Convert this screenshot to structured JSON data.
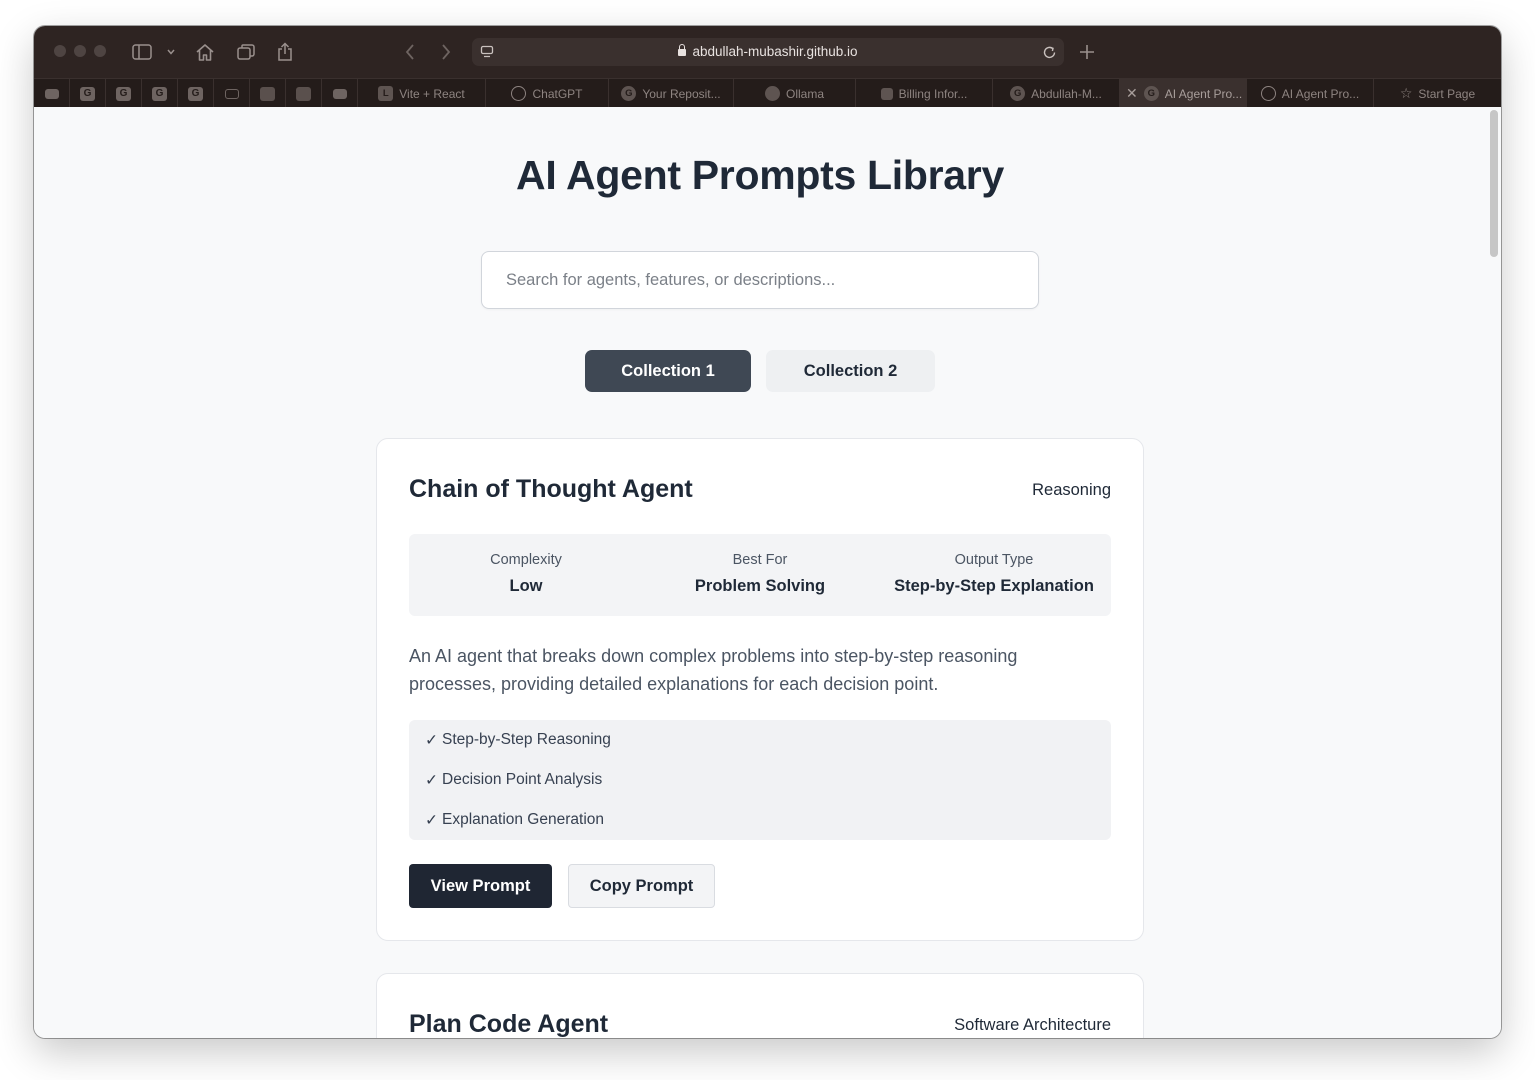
{
  "browser": {
    "url": "abdullah-mubashir.github.io",
    "pinned_tabs": [
      {
        "icon": "youtube-icon",
        "letter": ""
      },
      {
        "icon": "github-icon",
        "letter": "G"
      },
      {
        "icon": "github-icon",
        "letter": "G"
      },
      {
        "icon": "github-icon",
        "letter": "G"
      },
      {
        "icon": "github-icon",
        "letter": "G"
      },
      {
        "icon": "list-icon",
        "letter": ""
      },
      {
        "icon": "image-icon",
        "letter": ""
      },
      {
        "icon": "image-icon",
        "letter": ""
      },
      {
        "icon": "youtube-icon",
        "letter": ""
      }
    ],
    "tabs": [
      {
        "label": "Vite + React",
        "icon_letter": "L"
      },
      {
        "label": "ChatGPT",
        "icon_letter": "✱"
      },
      {
        "label": "Your Reposit...",
        "icon_letter": "G"
      },
      {
        "label": "Ollama",
        "icon_letter": "☺"
      },
      {
        "label": "Billing Infor...",
        "icon_letter": "⚲"
      },
      {
        "label": "Abdullah-M...",
        "icon_letter": "G"
      },
      {
        "label": "AI Agent Pro...",
        "icon_letter": "G"
      },
      {
        "label": "AI Agent Pro...",
        "icon_letter": "⊘"
      },
      {
        "label": "Start Page",
        "icon_letter": "☆"
      }
    ],
    "close_glyph": "✕"
  },
  "page": {
    "title": "AI Agent Prompts Library",
    "search_placeholder": "Search for agents, features, or descriptions...",
    "collections": [
      "Collection 1",
      "Collection 2"
    ],
    "active_collection": "Collection 1"
  },
  "agents": [
    {
      "name": "Chain of Thought Agent",
      "category": "Reasoning",
      "meta": [
        {
          "label": "Complexity",
          "value": "Low"
        },
        {
          "label": "Best For",
          "value": "Problem Solving"
        },
        {
          "label": "Output Type",
          "value": "Step-by-Step Explanation"
        }
      ],
      "description": "An AI agent that breaks down complex problems into step-by-step reasoning processes, providing detailed explanations for each decision point.",
      "features": [
        "Step-by-Step Reasoning",
        "Decision Point Analysis",
        "Explanation Generation"
      ],
      "buttons": {
        "view": "View Prompt",
        "copy": "Copy Prompt"
      }
    },
    {
      "name": "Plan Code Agent",
      "category": "Software Architecture"
    }
  ],
  "feature_check": "✓",
  "colors": {
    "toolbar": "#2e2422",
    "page_bg": "#f8f9fa",
    "active_collection": "#3f4854",
    "view_button": "#1f2633",
    "text_dark": "#1f2937"
  }
}
